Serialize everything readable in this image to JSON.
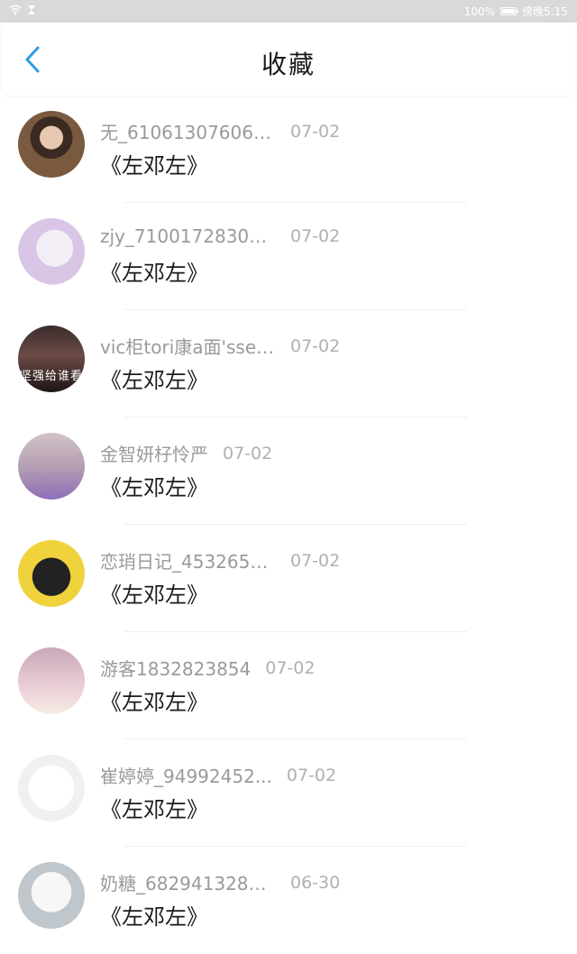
{
  "statusbar": {
    "battery": "100%",
    "time": "傍晚5:15",
    "wifi_icon": "wifi-icon",
    "hourglass_icon": "hourglass-icon"
  },
  "header": {
    "title": "收藏",
    "back_icon": "chevron-left-icon",
    "accent_color": "#2f9be4"
  },
  "items": [
    {
      "user": "无_610613076066...",
      "date": "07-02",
      "content": "《左邓左》"
    },
    {
      "user": "zjy_710017283065..",
      "date": "07-02",
      "content": "《左邓左》"
    },
    {
      "user": "vic柜tori康a面'ssec..",
      "date": "07-02",
      "content": "《左邓左》",
      "avatar_caption": "坚强给谁看"
    },
    {
      "user": "金智妍杍怜严",
      "date": "07-02",
      "content": "《左邓左》"
    },
    {
      "user": "恋琑日记_4532654...",
      "date": "07-02",
      "content": "《左邓左》"
    },
    {
      "user": "游客1832823854",
      "date": "07-02",
      "content": "《左邓左》"
    },
    {
      "user": "崔婷婷_94992452...",
      "date": "07-02",
      "content": "《左邓左》"
    },
    {
      "user": "奶糖_6829413283...",
      "date": "06-30",
      "content": "《左邓左》"
    }
  ]
}
